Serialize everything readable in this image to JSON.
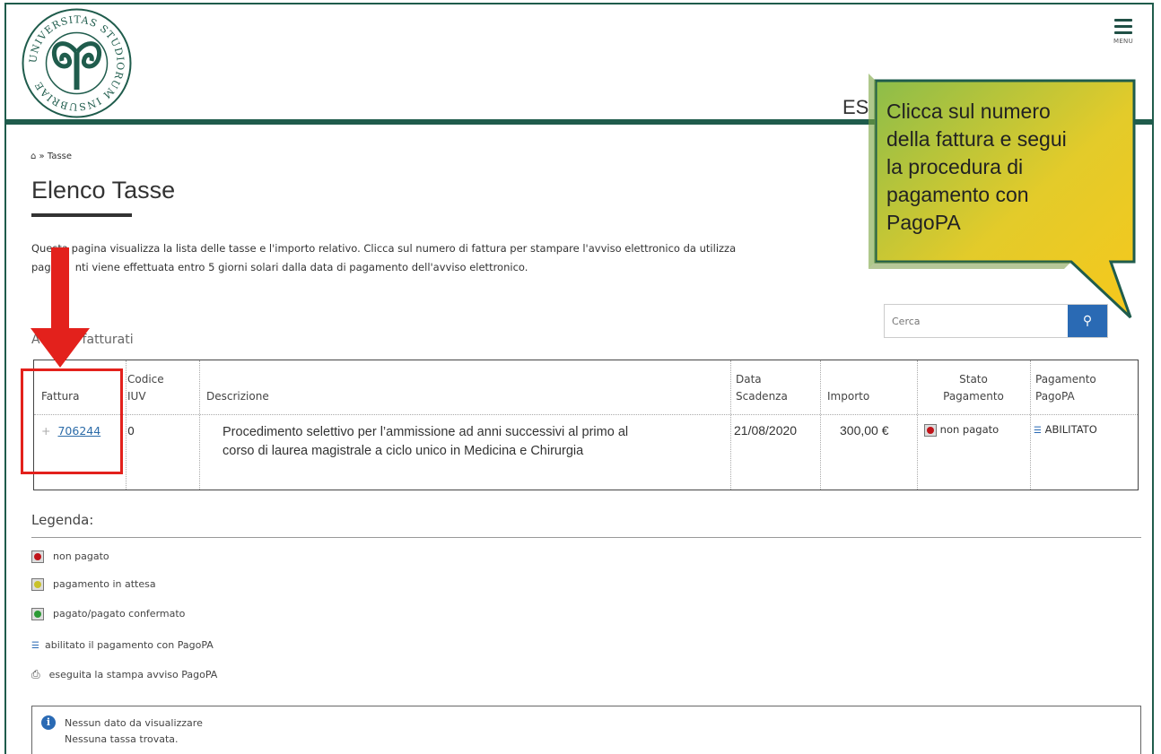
{
  "header": {
    "logo_text": "UNIVERSITAS STUDIORUM INSUBRIAE",
    "menu_label": "MENU",
    "es_text": "ES"
  },
  "breadcrumb": {
    "home_icon": "home-icon",
    "separator": "»",
    "current": "Tasse"
  },
  "page": {
    "title": "Elenco Tasse",
    "intro_line1": "Questa pagina visualizza la lista delle tasse e l'importo relativo. Clicca sul numero di fattura per stampare l'avviso elettronico da utilizza",
    "intro_line2_a": "paga",
    "intro_line2_b": "nti viene effettuata entro 5 giorni solari dalla data di pagamento dell'avviso elettronico."
  },
  "search": {
    "placeholder": "Cerca",
    "button_icon": "search-icon"
  },
  "section": {
    "label_a": "Ad",
    "label_b": "i fatturati"
  },
  "table": {
    "headers": {
      "fattura": "Fattura",
      "codice_1": "Codice",
      "codice_2": "IUV",
      "descrizione": "Descrizione",
      "data_1": "Data",
      "data_2": "Scadenza",
      "importo": "Importo",
      "stato_1": "Stato",
      "stato_2": "Pagamento",
      "pagopa_1": "Pagamento",
      "pagopa_2": "PagoPA"
    },
    "row": {
      "expand": "+",
      "fattura": "706244",
      "iuv": "0",
      "descrizione_1": "Procedimento selettivo per l’ammissione ad anni successivi al primo al",
      "descrizione_2": "corso di laurea magistrale a ciclo unico in Medicina e Chirurgia",
      "data_scadenza": "21/08/2020",
      "importo": "300,00 €",
      "stato": "non pagato",
      "pagopa": "ABILITATO"
    }
  },
  "legend": {
    "title": "Legenda:",
    "items": [
      {
        "label": "non pagato",
        "icon": "red-status-icon"
      },
      {
        "label": "pagamento in attesa",
        "icon": "yellow-status-icon"
      },
      {
        "label": "pagato/pagato confermato",
        "icon": "green-status-icon"
      },
      {
        "label": "abilitato il pagamento con PagoPA",
        "icon": "pagopa-icon"
      },
      {
        "label": "eseguita la stampa avviso PagoPA",
        "icon": "printer-icon"
      }
    ]
  },
  "info": {
    "line1": "Nessun dato da visualizzare",
    "line2": "Nessuna tassa trovata."
  },
  "callout": {
    "line1": "Clicca sul numero",
    "line2": "della fattura e segui",
    "line3": "la procedura di",
    "line4": "pagamento con",
    "line5": "PagoPA"
  },
  "colors": {
    "brand_green": "#1f5c4c",
    "callout_green": "#8cbd4a",
    "callout_yellow": "#f6cf1f",
    "highlight_red": "#e3211c",
    "search_blue": "#2a6ab4"
  }
}
